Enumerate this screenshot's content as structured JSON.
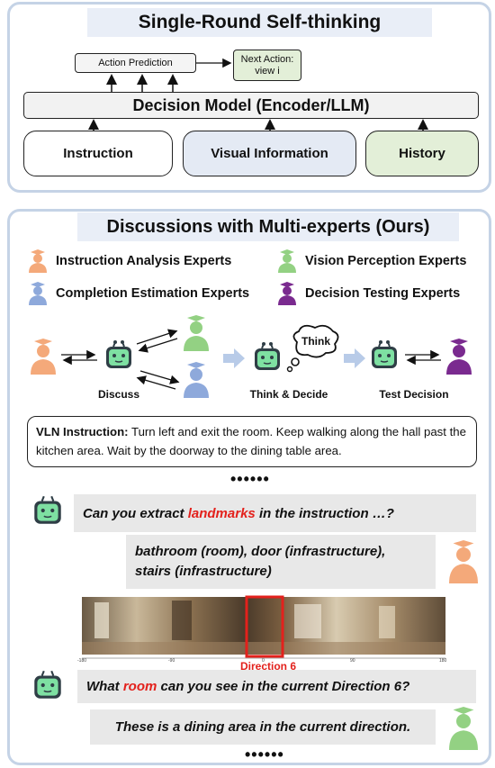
{
  "top_panel": {
    "title": "Single-Round Self-thinking",
    "action_prediction": "Action Prediction",
    "next_action_line1": "Next Action:",
    "next_action_line2": "view i",
    "decision_model": "Decision Model (Encoder/LLM)",
    "inputs": [
      "Instruction",
      "Visual Information",
      "History"
    ],
    "colors": {
      "visual": "#e4eaf4",
      "history": "#e3efd8",
      "next_action": "#e3efd8"
    }
  },
  "bottom_panel": {
    "title": "Discussions with Multi-experts (Ours)",
    "experts": [
      {
        "label": "Instruction Analysis Experts",
        "color": "#f4a97a",
        "icon": "expert-orange-icon"
      },
      {
        "label": "Vision Perception Experts",
        "color": "#93d183",
        "icon": "expert-green-icon"
      },
      {
        "label": "Completion Estimation Experts",
        "color": "#8ea9db",
        "icon": "expert-blue-icon"
      },
      {
        "label": "Decision Testing Experts",
        "color": "#7a2a8f",
        "icon": "expert-purple-icon"
      }
    ],
    "flow": {
      "discuss": "Discuss",
      "think_decide": "Think & Decide",
      "think_bubble": "Think",
      "test_decision": "Test Decision"
    },
    "instruction": {
      "label": "VLN Instruction:",
      "text": " Turn left and exit the room. Keep walking along the hall past the kitchen area. Wait by the doorway to the dining table area."
    },
    "ellipsis": "••••••",
    "dialogue": {
      "q1_pre": "Can you extract ",
      "q1_highlight": "landmarks",
      "q1_post": " in the instruction …?",
      "a1_line1": "bathroom (room), door (infrastructure),",
      "a1_line2": "stairs (infrastructure)",
      "direction_label": "Direction 6",
      "pano_ticks": [
        "-180",
        "-90",
        "0",
        "90",
        "180"
      ],
      "q2_pre": "What ",
      "q2_highlight": "room",
      "q2_post": " can you see in the current Direction 6?",
      "a2": "These is a dining area in the current direction."
    }
  }
}
